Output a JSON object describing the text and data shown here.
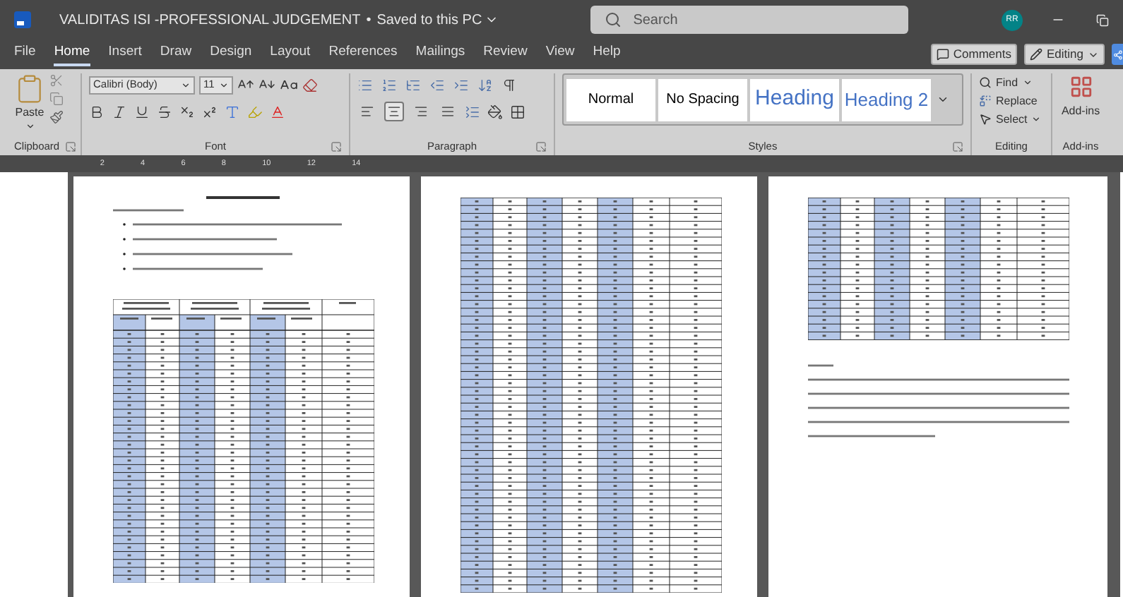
{
  "window": {
    "title": "VALIDITAS ISI -PROFESSIONAL JUDGEMENT",
    "separator": "•",
    "save_status": "Saved to this PC",
    "search_placeholder": "Search",
    "user_initials": "RR"
  },
  "menu_tabs": [
    {
      "label": "File",
      "selected": false
    },
    {
      "label": "Home",
      "selected": true
    },
    {
      "label": "Insert",
      "selected": false
    },
    {
      "label": "Draw",
      "selected": false
    },
    {
      "label": "Design",
      "selected": false
    },
    {
      "label": "Layout",
      "selected": false
    },
    {
      "label": "References",
      "selected": false
    },
    {
      "label": "Mailings",
      "selected": false
    },
    {
      "label": "Review",
      "selected": false
    },
    {
      "label": "View",
      "selected": false
    },
    {
      "label": "Help",
      "selected": false
    }
  ],
  "comments_button": "Comments",
  "editing_button": "Editing",
  "ribbon": {
    "clipboard": {
      "paste": "Paste",
      "group": "Clipboard"
    },
    "font": {
      "family": "Calibri (Body)",
      "size": "11",
      "group": "Font"
    },
    "paragraph": {
      "alignments": [
        {
          "kind": "left",
          "selected": false
        },
        {
          "kind": "center",
          "selected": true
        },
        {
          "kind": "right",
          "selected": false
        },
        {
          "kind": "justify",
          "selected": false
        }
      ],
      "group": "Paragraph"
    },
    "styles": {
      "items": [
        {
          "label": "Normal",
          "kind": "normal"
        },
        {
          "label": "No Spacing",
          "kind": "nospacing"
        },
        {
          "label": "Heading",
          "kind": "heading1"
        },
        {
          "label": "Heading 2",
          "kind": "heading2"
        }
      ],
      "group": "Styles"
    },
    "editing": {
      "find": "Find",
      "replace": "Replace",
      "select": "Select",
      "group": "Editing"
    },
    "addins": {
      "label": "Add-ins",
      "group": "Add-ins"
    }
  },
  "ruler": {
    "labels": [
      "2",
      "4",
      "6",
      "8",
      "10",
      "12",
      "14"
    ]
  },
  "pages": [
    {
      "kind": "intro_table"
    },
    {
      "kind": "table"
    },
    {
      "kind": "table_conclusion"
    }
  ]
}
